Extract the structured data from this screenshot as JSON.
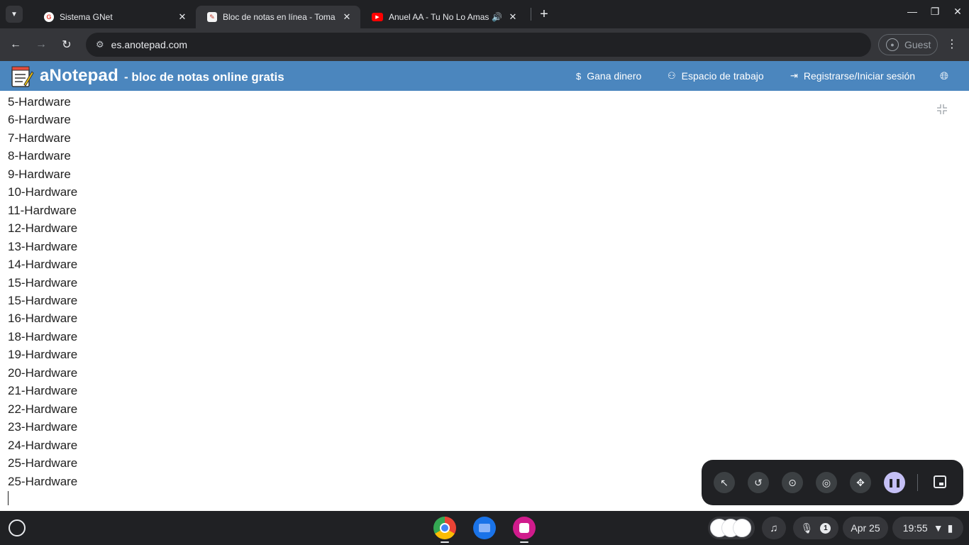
{
  "browser": {
    "tabs": [
      {
        "title": "Sistema GNet",
        "favicon": "google-g-icon",
        "active": false
      },
      {
        "title": "Bloc de notas en línea - Toma y",
        "favicon": "notepad-icon",
        "active": true
      },
      {
        "title": "Anuel AA - Tu No Lo Amas",
        "favicon": "youtube-icon",
        "active": false,
        "audio": true
      }
    ],
    "url": "es.anotepad.com",
    "profile_label": "Guest"
  },
  "site": {
    "brand": "aNotepad",
    "tagline": "- bloc de notas online gratis",
    "nav": [
      {
        "label": "Gana dinero",
        "icon": "dollar-icon"
      },
      {
        "label": "Espacio de trabajo",
        "icon": "people-icon"
      },
      {
        "label": "Registrarse/Iniciar sesión",
        "icon": "login-icon"
      }
    ],
    "colors": {
      "header_bg": "#4b86be",
      "accent_text": "#ffffff"
    }
  },
  "note": {
    "lines": [
      "5-Hardware",
      "6-Hardware",
      "7-Hardware",
      "8-Hardware",
      "9-Hardware",
      "10-Hardware",
      "11-Hardware",
      "12-Hardware",
      "13-Hardware",
      "14-Hardware",
      "15-Hardware",
      "15-Hardware",
      "16-Hardware",
      "18-Hardware",
      "19-Hardware",
      "20-Hardware",
      "21-Hardware",
      "22-Hardware",
      "23-Hardware",
      "24-Hardware",
      "25-Hardware",
      "25-Hardware"
    ]
  },
  "shelf": {
    "date": "Apr 25",
    "time": "19:55",
    "mic_badge": "1",
    "apps": [
      "chrome-icon",
      "files-icon",
      "canvas-icon"
    ]
  }
}
